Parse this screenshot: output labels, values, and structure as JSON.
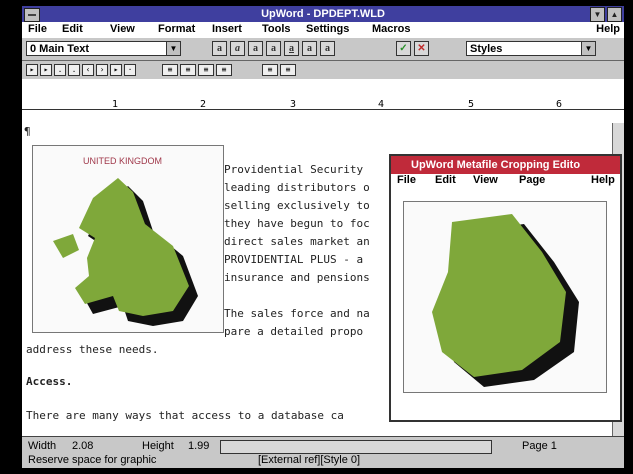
{
  "window": {
    "title": "UpWord - DPDEPT.WLD",
    "help_label": "Help"
  },
  "menu": [
    "File",
    "Edit",
    "View",
    "Format",
    "Insert",
    "Tools",
    "Settings",
    "Macros"
  ],
  "toolbar": {
    "style_combo": "0 Main Text",
    "styles_combo": "Styles",
    "buttons": [
      "a",
      "a",
      "a",
      "a",
      "a",
      "a",
      "a"
    ],
    "check": "✓",
    "cross": "✕"
  },
  "ruler": {
    "numbers": [
      "1",
      "2",
      "3",
      "4",
      "5",
      "6"
    ]
  },
  "document": {
    "para_mark": "¶",
    "lines": [
      "Providential Security",
      "leading distributors o",
      "selling exclusively to",
      "they have begun to foc",
      "direct sales market an",
      "PROVIDENTIAL PLUS - a",
      "insurance and pensions",
      "The sales force and na",
      "pare a detailed propo",
      "address these needs.",
      "Access.",
      "There are many ways that access to a database ca"
    ],
    "map_label": "UNITED KINGDOM"
  },
  "crop_window": {
    "title": "UpWord Metafile Cropping Edito",
    "menu": [
      "File",
      "Edit",
      "View",
      "Page",
      "Help"
    ]
  },
  "status": {
    "width_label": "Width",
    "width": "2.08",
    "height_label": "Height",
    "height": "1.99",
    "page_label": "Page 1",
    "message": "Reserve space for graphic",
    "info": "[External ref][Style 0]"
  }
}
